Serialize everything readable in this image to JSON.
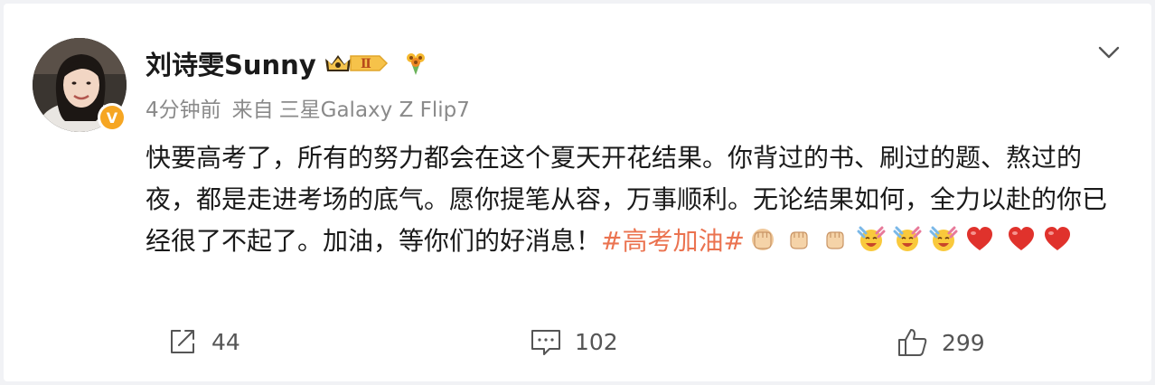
{
  "post": {
    "username": "刘诗雯Sunny",
    "vip_level": "Ⅱ",
    "verified_mark": "V",
    "time": "4分钟前",
    "source_prefix": "来自",
    "source_device": "三星Galaxy Z Flip7",
    "text_part1": "快要高考了，所有的努力都会在这个夏天开花结果。你背过的书、刷过的题、熬过的夜，都是走进考场的底气。愿你提笔从容，万事顺利。无论结果如何，全力以赴的你已经很了不起了。加油，等你们的好消息！",
    "hashtag": "#高考加油#",
    "emojis": [
      "fist-icon",
      "fist-icon",
      "fist-icon",
      "cheer-icon",
      "cheer-icon",
      "cheer-icon",
      "heart-icon",
      "heart-icon",
      "heart-icon"
    ]
  },
  "actions": {
    "repost_count": "44",
    "comment_count": "102",
    "like_count": "299"
  },
  "colors": {
    "hashtag": "#eb7350",
    "badge": "#f6a623",
    "heart": "#e0322c"
  }
}
